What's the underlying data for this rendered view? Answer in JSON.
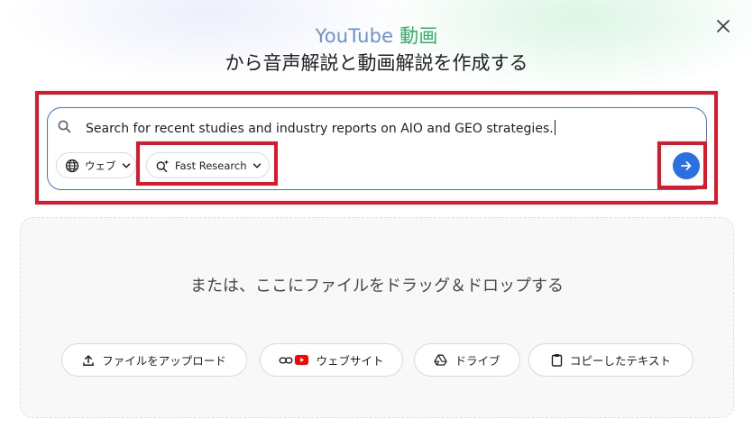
{
  "header": {
    "title_part1": "YouTube ",
    "title_part2": "動画",
    "subtitle": "から音声解説と動画解説を作成する"
  },
  "search": {
    "query": "Search for recent studies and industry reports on AIO and GEO strategies.",
    "source_chip_label": "ウェブ",
    "mode_chip_label": "Fast Research"
  },
  "dropzone": {
    "prompt": "または、ここにファイルをドラッグ＆ドロップする",
    "buttons": [
      {
        "label": "ファイルをアップロード",
        "icon": "upload-icon"
      },
      {
        "label": "ウェブサイト",
        "icon": "link-youtube-icon"
      },
      {
        "label": "ドライブ",
        "icon": "drive-icon"
      },
      {
        "label": "コピーしたテキスト",
        "icon": "clipboard-icon"
      }
    ]
  },
  "colors": {
    "accent": "#2a6fe3",
    "highlight": "#e0162b",
    "title_blue": "#6b8fd9",
    "title_green": "#35b06a"
  }
}
